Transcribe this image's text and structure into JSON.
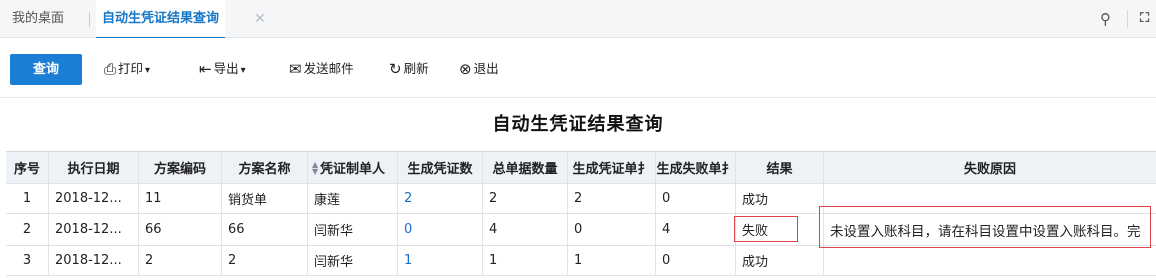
{
  "tabs": {
    "home": "我的桌面",
    "active": "自动生凭证结果查询",
    "close": "✕"
  },
  "toolbar": {
    "query": "查询",
    "print": "打印",
    "export": "导出",
    "send_mail": "发送邮件",
    "refresh": "刷新",
    "exit": "退出"
  },
  "report": {
    "title": "自动生凭证结果查询"
  },
  "table": {
    "headers": [
      "序号",
      "执行日期",
      "方案编码",
      "方案名称",
      "凭证制单人",
      "生成凭证数",
      "总单据数量",
      "生成凭证单扌",
      "生成失败单扌",
      "结果",
      "失败原因"
    ],
    "rows": [
      [
        "1",
        "2018-12...",
        "11",
        "销货单",
        "康莲",
        "2",
        "2",
        "2",
        "0",
        "成功",
        ""
      ],
      [
        "2",
        "2018-12...",
        "66",
        "66",
        "闫新华",
        "0",
        "4",
        "0",
        "4",
        "失败",
        "未设置入账科目，请在科目设置中设置入账科目。完"
      ],
      [
        "3",
        "2018-12...",
        "2",
        "2",
        "闫新华",
        "1",
        "1",
        "1",
        "0",
        "成功",
        ""
      ]
    ]
  },
  "colors": {
    "accent": "#1a7ed4",
    "highlight": "#e0444b",
    "link": "#1a6fc4"
  }
}
